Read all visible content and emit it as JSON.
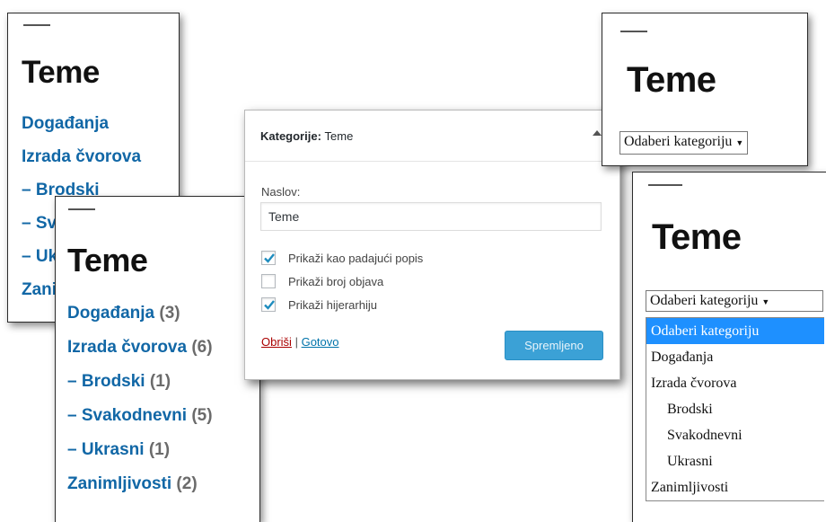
{
  "colors": {
    "link": "#1167a6",
    "count": "#6b6b6b",
    "save_button": "#3ba1d6",
    "delete_link": "#aa0000",
    "highlight": "#1e90ff"
  },
  "widget_list_back": {
    "title": "Teme",
    "items": [
      "Događanja",
      "Izrada čvorova",
      "– Brodski",
      "– Svakodnevni",
      "– Ukrasni",
      "Zanimljivosti"
    ]
  },
  "widget_list_front": {
    "title": "Teme",
    "items": [
      {
        "label": "Događanja",
        "count": "(3)"
      },
      {
        "label": "Izrada čvorova",
        "count": "(6)"
      },
      {
        "label": "– Brodski",
        "count": "(1)"
      },
      {
        "label": "– Svakodnevni",
        "count": "(5)"
      },
      {
        "label": "– Ukrasni",
        "count": "(1)"
      },
      {
        "label": "Zanimljivosti",
        "count": "(2)"
      }
    ]
  },
  "settings": {
    "header_title": "Kategorije:",
    "header_subtitle": "Teme",
    "title_label": "Naslov:",
    "title_value": "Teme",
    "options": [
      {
        "label": "Prikaži kao padajući popis",
        "checked": true
      },
      {
        "label": "Prikaži broj objava",
        "checked": false
      },
      {
        "label": "Prikaži hijerarhiju",
        "checked": true
      }
    ],
    "delete_label": "Obriši",
    "separator": "|",
    "done_label": "Gotovo",
    "save_label": "Spremljeno"
  },
  "widget_dropdown_back": {
    "title": "Teme",
    "select_value": "Odaberi kategoriju",
    "select_arrow": "▼"
  },
  "widget_dropdown_front": {
    "title": "Teme",
    "select_value": "Odaberi kategoriju",
    "select_arrow": "▼",
    "options": [
      {
        "label": "Odaberi kategoriju",
        "selected": true,
        "child": false
      },
      {
        "label": "Događanja",
        "selected": false,
        "child": false
      },
      {
        "label": "Izrada čvorova",
        "selected": false,
        "child": false
      },
      {
        "label": "Brodski",
        "selected": false,
        "child": true
      },
      {
        "label": "Svakodnevni",
        "selected": false,
        "child": true
      },
      {
        "label": "Ukrasni",
        "selected": false,
        "child": true
      },
      {
        "label": "Zanimljivosti",
        "selected": false,
        "child": false
      }
    ]
  }
}
